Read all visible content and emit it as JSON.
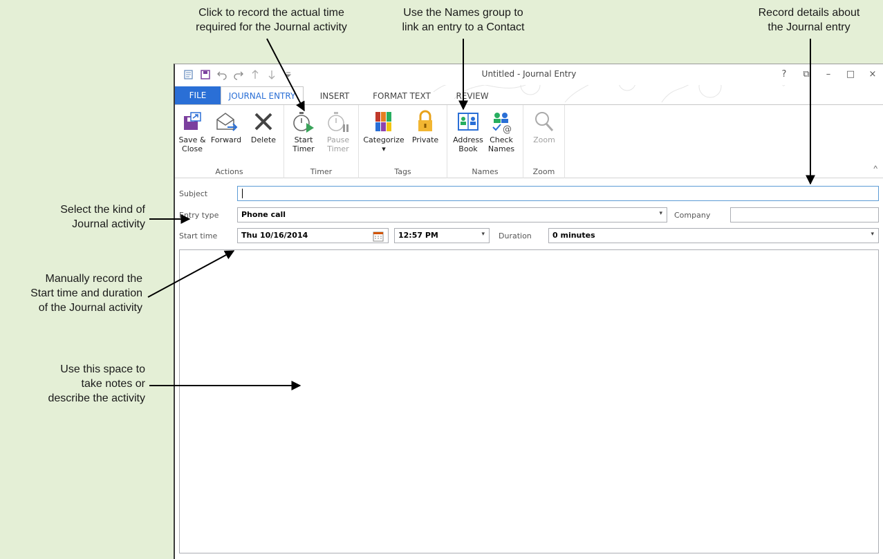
{
  "callouts": {
    "timer": [
      "Click to record the actual time",
      "required for the Journal activity"
    ],
    "names": [
      "Use the Names group to",
      "link an entry to a Contact"
    ],
    "details": [
      "Record details about",
      "the Journal entry"
    ],
    "kind": [
      "Select the kind of",
      "Journal activity"
    ],
    "start": [
      "Manually record the",
      "Start time and duration",
      "of the Journal activity"
    ],
    "notes": [
      "Use this space to",
      "take notes or",
      "describe the activity"
    ]
  },
  "window": {
    "title": "Untitled - Journal Entry",
    "controls": [
      "?",
      "⧉",
      "–",
      "□",
      "×"
    ]
  },
  "tabs": [
    "FILE",
    "JOURNAL ENTRY",
    "INSERT",
    "FORMAT TEXT",
    "REVIEW"
  ],
  "ribbon": {
    "groups": {
      "actions": "Actions",
      "timer": "Timer",
      "tags": "Tags",
      "names": "Names",
      "zoom": "Zoom"
    },
    "buttons": {
      "save_close": [
        "Save &",
        "Close"
      ],
      "forward": [
        "Forward",
        ""
      ],
      "delete": [
        "Delete",
        ""
      ],
      "start_timer": [
        "Start",
        "Timer"
      ],
      "pause_timer": [
        "Pause",
        "Timer"
      ],
      "categorize": [
        "Categorize",
        "▾"
      ],
      "private": [
        "Private",
        ""
      ],
      "address_book": [
        "Address",
        "Book"
      ],
      "check_names": [
        "Check",
        "Names"
      ],
      "zoom": [
        "Zoom",
        ""
      ]
    },
    "collapse": "^"
  },
  "form": {
    "subject_label": "Subject",
    "subject_value": "",
    "entry_type_label": "Entry type",
    "entry_type_value": "Phone call",
    "company_label": "Company",
    "company_value": "",
    "start_time_label": "Start time",
    "start_date_value": "Thu 10/16/2014",
    "start_time_value": "12:57 PM",
    "duration_label": "Duration",
    "duration_value": "0 minutes"
  },
  "colors": {
    "background": "#e4efd6",
    "accent": "#2a6fd6",
    "file_tab": "#2a6fd6"
  }
}
